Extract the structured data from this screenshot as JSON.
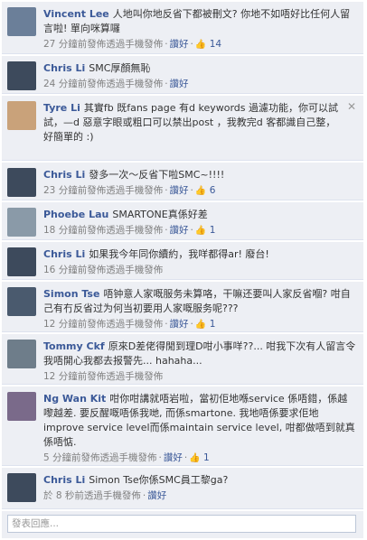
{
  "comments": [
    {
      "author": "Vincent Lee",
      "text": "人地叫你地反省下都被刪文? 你地不如唔好比任何人留言啦! 單向咪算囉",
      "time": "27 分鐘前發佈透過手機發佈",
      "like_label": "讚好",
      "likes": "14",
      "avatar_color": "#6b7f99"
    },
    {
      "author": "Chris Li",
      "text": "SMC厚顏無恥",
      "time": "24 分鐘前發佈透過手機發佈",
      "like_label": "讚好",
      "avatar_color": "#3d4a5c"
    },
    {
      "author": "Tyre Li",
      "text": "其實fb 既fans page 有d keywords 過濾功能，你可以試試，—d 惡意字眼或粗口可以禁出post ，我教完d 客都識自己整，好簡單的 :)",
      "time": "",
      "avatar_color": "#c9a27a"
    },
    {
      "author": "Chris Li",
      "text": "發多一次～反省下啦SMC~!!!!",
      "time": "23 分鐘前發佈透過手機發佈",
      "like_label": "讚好",
      "likes": "6",
      "avatar_color": "#3d4a5c"
    },
    {
      "author": "Phoebe Lau",
      "text": "SMARTONE真係好差",
      "time": "18 分鐘前發佈透過手機發佈",
      "like_label": "讚好",
      "likes": "1",
      "avatar_color": "#8a9aa8"
    },
    {
      "author": "Chris Li",
      "text": "如果我今年同你續約，我咩都得ar! 廢台!",
      "time": "16 分鐘前發佈透過手機發佈",
      "avatar_color": "#3d4a5c"
    },
    {
      "author": "Simon Tse",
      "text": "唔钟意人家嘅服务未算咯，干嘛还要叫人家反省嗰? 咁自己有冇反省过为何当初要用人家嘅服务呢???",
      "time": "12 分鐘前發佈透過手機發佈",
      "like_label": "讚好",
      "likes": "1",
      "avatar_color": "#4a5a6e"
    },
    {
      "author": "Tommy Ckf",
      "text": "原來D差佬得閒到理D咁小事咩??... 咁我下次有人留言令我唔開心我都去报警先... hahaha...",
      "time": "12 分鐘前發佈透過手機發佈",
      "avatar_color": "#6e7d8a"
    },
    {
      "author": "Ng Wan Kit",
      "text": "咁你咁講就唔岩啦，當初佢地喺service 係唔錯，係越嚟越差. 要反醒嘅唔係我哋, 而係smartone. 我地唔係要求佢地improve service level而係maintain service level, 咁都做唔到就真係唔惦.",
      "time": "5 分鐘前發佈透過手機發佈",
      "like_label": "讚好",
      "likes": "1",
      "avatar_color": "#7a6a8a"
    },
    {
      "author": "Chris Li",
      "text": "Simon Tse你係SMC員工黎ga?",
      "time": "於 8 秒前透過手機發佈",
      "like_label": "讚好",
      "avatar_color": "#3d4a5c"
    }
  ],
  "reply": {
    "placeholder": "發表回應..."
  }
}
